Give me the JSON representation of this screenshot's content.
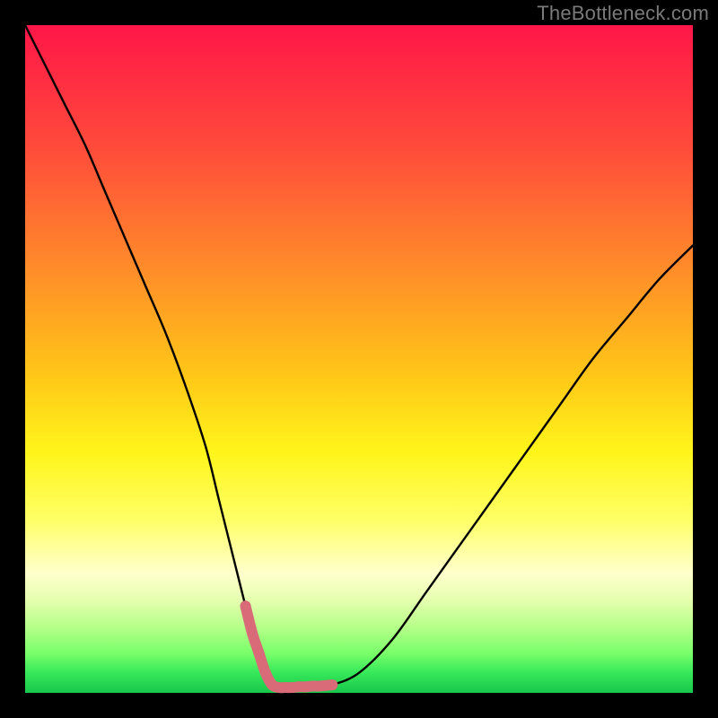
{
  "watermark": "TheBottleneck.com",
  "chart_data": {
    "type": "line",
    "title": "",
    "xlabel": "",
    "ylabel": "",
    "xlim": [
      0,
      100
    ],
    "ylim": [
      0,
      100
    ],
    "series": [
      {
        "name": "bottleneck-curve",
        "x": [
          0,
          3,
          6,
          9,
          12,
          15,
          18,
          21,
          24,
          27,
          29,
          31,
          33,
          34.5,
          36,
          37,
          38,
          40,
          42,
          44,
          46,
          50,
          55,
          60,
          65,
          70,
          75,
          80,
          85,
          90,
          95,
          100
        ],
        "values": [
          100,
          94,
          88,
          82,
          75,
          68,
          61,
          54,
          46,
          37,
          29,
          21,
          13,
          7,
          3,
          1.2,
          0.8,
          0.8,
          0.9,
          1.0,
          1.2,
          3,
          8,
          15,
          22,
          29,
          36,
          43,
          50,
          56,
          62,
          67
        ]
      }
    ],
    "highlight": {
      "name": "bottom-segment",
      "x": [
        33,
        34,
        35,
        36,
        37,
        38,
        39,
        40,
        41,
        42,
        43,
        44,
        45,
        46
      ],
      "values": [
        13,
        9,
        6,
        3,
        1.2,
        0.8,
        0.8,
        0.8,
        0.9,
        0.9,
        1.0,
        1.0,
        1.1,
        1.2
      ]
    },
    "gradient_bands": [
      {
        "color": "magenta-red",
        "y_pct": 0
      },
      {
        "color": "red",
        "y_pct": 15
      },
      {
        "color": "orange",
        "y_pct": 40
      },
      {
        "color": "yellow",
        "y_pct": 65
      },
      {
        "color": "pale-yellow",
        "y_pct": 80
      },
      {
        "color": "light-green",
        "y_pct": 90
      },
      {
        "color": "green",
        "y_pct": 100
      }
    ]
  }
}
